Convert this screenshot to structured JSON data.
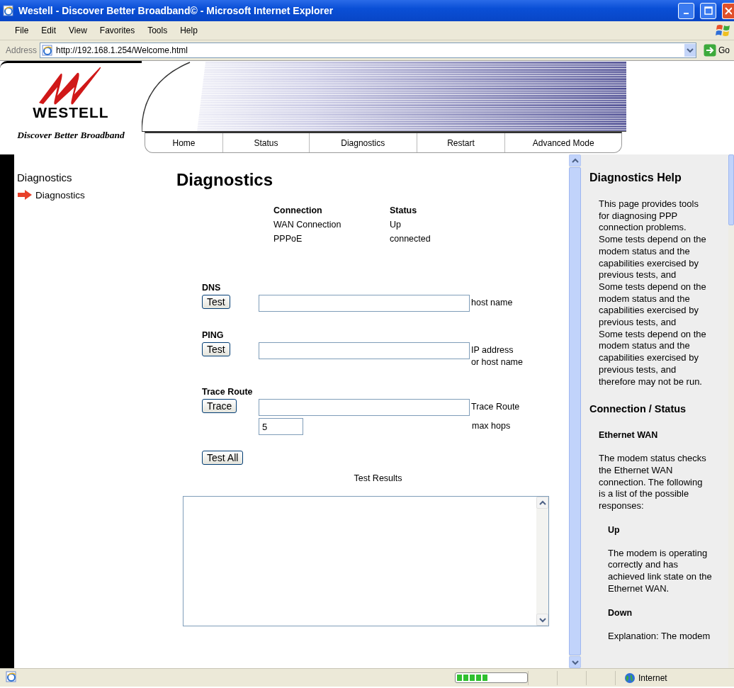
{
  "window": {
    "title": "Westell - Discover Better Broadband© - Microsoft Internet Explorer"
  },
  "menu": [
    "File",
    "Edit",
    "View",
    "Favorites",
    "Tools",
    "Help"
  ],
  "address_bar": {
    "label": "Address",
    "url": "http://192.168.1.254/Welcome.html",
    "go": "Go"
  },
  "header": {
    "brand": "WESTELL",
    "tagline": "Discover Better Broadband",
    "tabs": [
      "Home",
      "Status",
      "Diagnostics",
      "Restart",
      "Advanced Mode"
    ]
  },
  "sidebar": {
    "title": "Diagnostics",
    "items": [
      {
        "label": "Diagnostics",
        "selected": true
      }
    ]
  },
  "main": {
    "title": "Diagnostics",
    "status_table": {
      "columns": [
        "Connection",
        "Status"
      ],
      "rows": [
        [
          "WAN Connection",
          "Up"
        ],
        [
          "PPPoE",
          "connected"
        ]
      ]
    },
    "tests": [
      {
        "label": "DNS",
        "button": "Test",
        "hint": [
          "host name"
        ]
      },
      {
        "label": "PING",
        "button": "Test",
        "hint": [
          "IP address",
          "or host name"
        ]
      },
      {
        "label": "Trace Route",
        "button": "Trace",
        "hint": [
          "Trace Route"
        ],
        "hops": {
          "value": "5",
          "hint": "max hops"
        }
      }
    ],
    "test_all": "Test All",
    "results_label": "Test Results"
  },
  "help": {
    "title": "Diagnostics Help",
    "blocks": [
      {
        "kind": "p",
        "text": "This page provides tools for diagnosing PPP connection problems. Some tests depend on the modem status and the capabilities exercised by previous tests, and"
      },
      {
        "kind": "p",
        "text": "Some tests depend on the modem status and the capabilities exercised by previous tests, and"
      },
      {
        "kind": "p",
        "text": "Some tests depend on the modem status and the capabilities exercised by previous tests, and"
      },
      {
        "kind": "p",
        "text": "therefore may not be run."
      },
      {
        "kind": "h3",
        "text": "Connection / Status"
      },
      {
        "kind": "h4",
        "text": "Ethernet WAN"
      },
      {
        "kind": "p",
        "text": "The modem status checks the Ethernet WAN connection. The following is a list of the possible responses:"
      },
      {
        "kind": "h5",
        "text": "Up"
      },
      {
        "kind": "p2",
        "text": "The modem is operating correctly and has achieved link state on the Ethernet WAN."
      },
      {
        "kind": "h5",
        "text": "Down"
      },
      {
        "kind": "p2",
        "text": "Explanation: The modem"
      }
    ]
  },
  "status_bar": {
    "progress": {
      "level": 0.45
    },
    "zone": "Internet"
  }
}
